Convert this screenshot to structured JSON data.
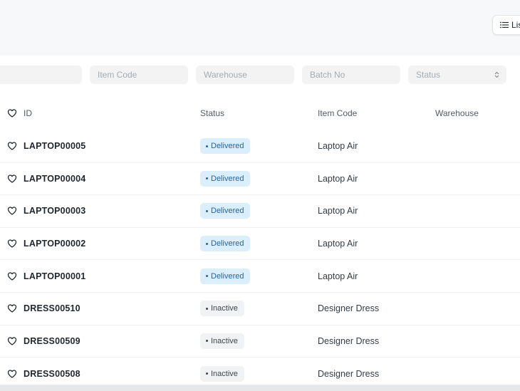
{
  "toolbar": {
    "view_label": "List View",
    "view_icon": "list-icon"
  },
  "filters": {
    "id_placeholder": "",
    "item_code_placeholder": "Item Code",
    "warehouse_placeholder": "Warehouse",
    "batch_no_placeholder": "Batch No",
    "status_placeholder": "Status"
  },
  "columns": {
    "id": "ID",
    "status": "Status",
    "item_code": "Item Code",
    "warehouse": "Warehouse"
  },
  "rows": [
    {
      "id": "LAPTOP00005",
      "status": "Delivered",
      "item_code": "Laptop Air",
      "warehouse": ""
    },
    {
      "id": "LAPTOP00004",
      "status": "Delivered",
      "item_code": "Laptop Air",
      "warehouse": ""
    },
    {
      "id": "LAPTOP00003",
      "status": "Delivered",
      "item_code": "Laptop Air",
      "warehouse": ""
    },
    {
      "id": "LAPTOP00002",
      "status": "Delivered",
      "item_code": "Laptop Air",
      "warehouse": ""
    },
    {
      "id": "LAPTOP00001",
      "status": "Delivered",
      "item_code": "Laptop Air",
      "warehouse": ""
    },
    {
      "id": "DRESS00510",
      "status": "Inactive",
      "item_code": "Designer Dress",
      "warehouse": ""
    },
    {
      "id": "DRESS00509",
      "status": "Inactive",
      "item_code": "Designer Dress",
      "warehouse": ""
    },
    {
      "id": "DRESS00508",
      "status": "Inactive",
      "item_code": "Designer Dress",
      "warehouse": ""
    }
  ],
  "colors": {
    "delivered_bg": "#dbeefc",
    "delivered_text": "#2166a8",
    "inactive_bg": "#f1f2f3",
    "inactive_text": "#3d464e"
  }
}
